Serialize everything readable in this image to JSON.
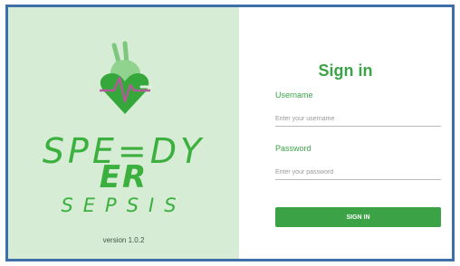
{
  "brand": {
    "name": "SPE=DY",
    "sub": "ER",
    "tag": "SEPSIS",
    "version": "version 1.0.2",
    "colors": {
      "green": "#3bb03f",
      "panel_bg": "#d6ecd4",
      "heart": "#36a83b",
      "pulse": "#b45a9a"
    }
  },
  "login": {
    "title": "Sign in",
    "username_label": "Username",
    "username_placeholder": "Enter your username",
    "username_value": "",
    "password_label": "Password",
    "password_placeholder": "Enter your password",
    "password_value": "",
    "button_label": "SIGN IN"
  }
}
